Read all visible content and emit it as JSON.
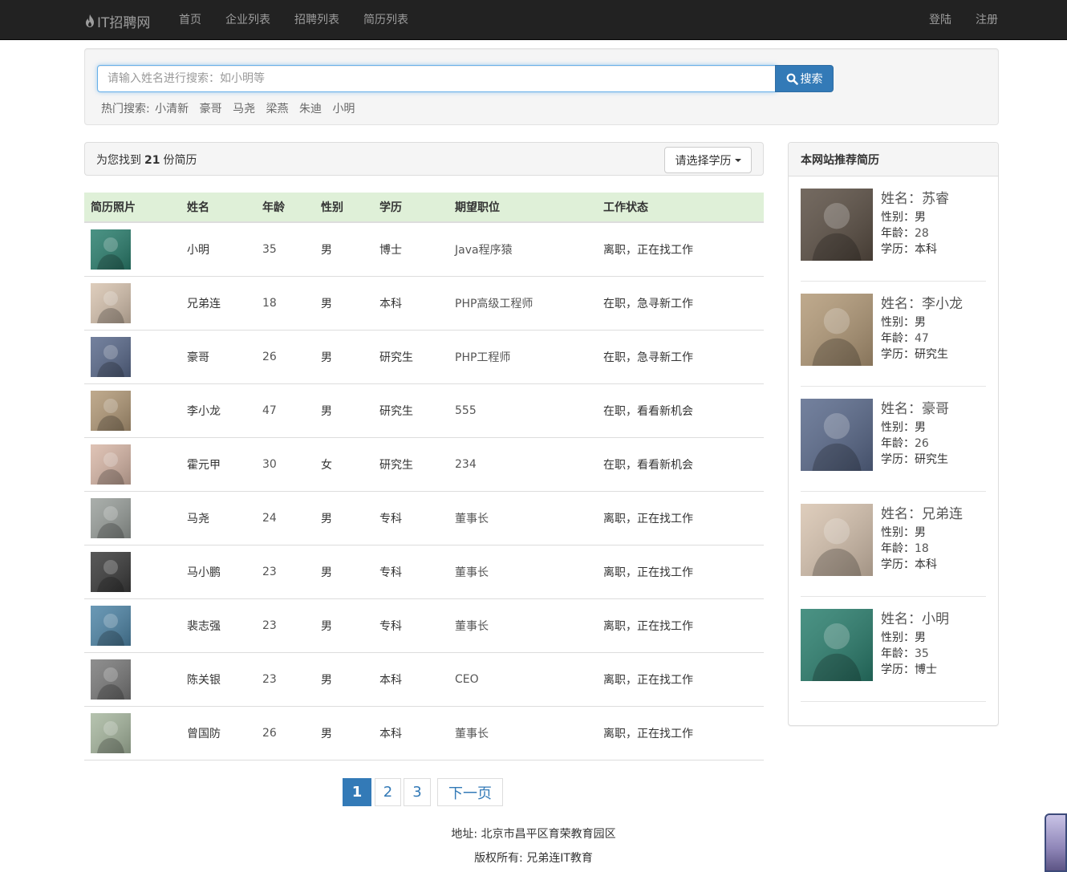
{
  "navbar": {
    "brand": "IT招聘网",
    "links": [
      "首页",
      "企业列表",
      "招聘列表",
      "简历列表"
    ],
    "login": "登陆",
    "register": "注册"
  },
  "search": {
    "placeholder": "请输入姓名进行搜索：如小明等",
    "button_label": "搜索",
    "hot_label": "热门搜索:",
    "hot_items": [
      "小清新",
      "豪哥",
      "马尧",
      "梁燕",
      "朱迪",
      "小明"
    ]
  },
  "results": {
    "prefix": "为您找到",
    "count": "21",
    "suffix": "份简历",
    "education_dropdown": "请选择学历"
  },
  "table": {
    "headers": [
      "简历照片",
      "姓名",
      "年龄",
      "性别",
      "学历",
      "期望职位",
      "工作状态"
    ],
    "rows": [
      {
        "name": "小明",
        "age": "35",
        "gender": "男",
        "education": "博士",
        "position": "Java程序猿",
        "status": "离职，正在找工作",
        "photo_color": "#2a7f6e"
      },
      {
        "name": "兄弟连",
        "age": "18",
        "gender": "男",
        "education": "本科",
        "position": "PHP高级工程师",
        "status": "在职，急寻新工作",
        "photo_color": "#d8c4b0"
      },
      {
        "name": "豪哥",
        "age": "26",
        "gender": "男",
        "education": "研究生",
        "position": "PHP工程师",
        "status": "在职，急寻新工作",
        "photo_color": "#5a6a8c"
      },
      {
        "name": "李小龙",
        "age": "47",
        "gender": "男",
        "education": "研究生",
        "position": "555",
        "status": "在职，看看新机会",
        "photo_color": "#b39a78"
      },
      {
        "name": "霍元甲",
        "age": "30",
        "gender": "女",
        "education": "研究生",
        "position": "234",
        "status": "在职，看看新机会",
        "photo_color": "#d9b8a8"
      },
      {
        "name": "马尧",
        "age": "24",
        "gender": "男",
        "education": "专科",
        "position": "董事长",
        "status": "离职，正在找工作",
        "photo_color": "#9aa09c"
      },
      {
        "name": "马小鹏",
        "age": "23",
        "gender": "男",
        "education": "专科",
        "position": "董事长",
        "status": "离职，正在找工作",
        "photo_color": "#3a3a3a"
      },
      {
        "name": "裴志强",
        "age": "23",
        "gender": "男",
        "education": "专科",
        "position": "董事长",
        "status": "离职，正在找工作",
        "photo_color": "#4f86a8"
      },
      {
        "name": "陈关银",
        "age": "23",
        "gender": "男",
        "education": "本科",
        "position": "CEO",
        "status": "离职，正在找工作",
        "photo_color": "#7a7a7a"
      },
      {
        "name": "曾国防",
        "age": "26",
        "gender": "男",
        "education": "本科",
        "position": "董事长",
        "status": "离职，正在找工作",
        "photo_color": "#a8b8a0"
      }
    ]
  },
  "sidebar": {
    "title": "本网站推荐简历",
    "labels": {
      "name": "姓名：",
      "gender": "性别：",
      "age": "年龄：",
      "education": "学历："
    },
    "items": [
      {
        "name": "苏睿",
        "gender": "男",
        "age": "28",
        "education": "本科",
        "photo_color": "#5b4f44"
      },
      {
        "name": "李小龙",
        "gender": "男",
        "age": "47",
        "education": "研究生",
        "photo_color": "#b39a78"
      },
      {
        "name": "豪哥",
        "gender": "男",
        "age": "26",
        "education": "研究生",
        "photo_color": "#5a6a8c"
      },
      {
        "name": "兄弟连",
        "gender": "男",
        "age": "18",
        "education": "本科",
        "photo_color": "#d8c4b0"
      },
      {
        "name": "小明",
        "gender": "男",
        "age": "35",
        "education": "博士",
        "photo_color": "#2a7f6e"
      }
    ]
  },
  "pagination": {
    "pages": [
      "1",
      "2",
      "3"
    ],
    "active": "1",
    "next": "下一页"
  },
  "footer": {
    "address": "地址: 北京市昌平区育荣教育园区",
    "copyright": "版权所有: 兄弟连IT教育"
  }
}
